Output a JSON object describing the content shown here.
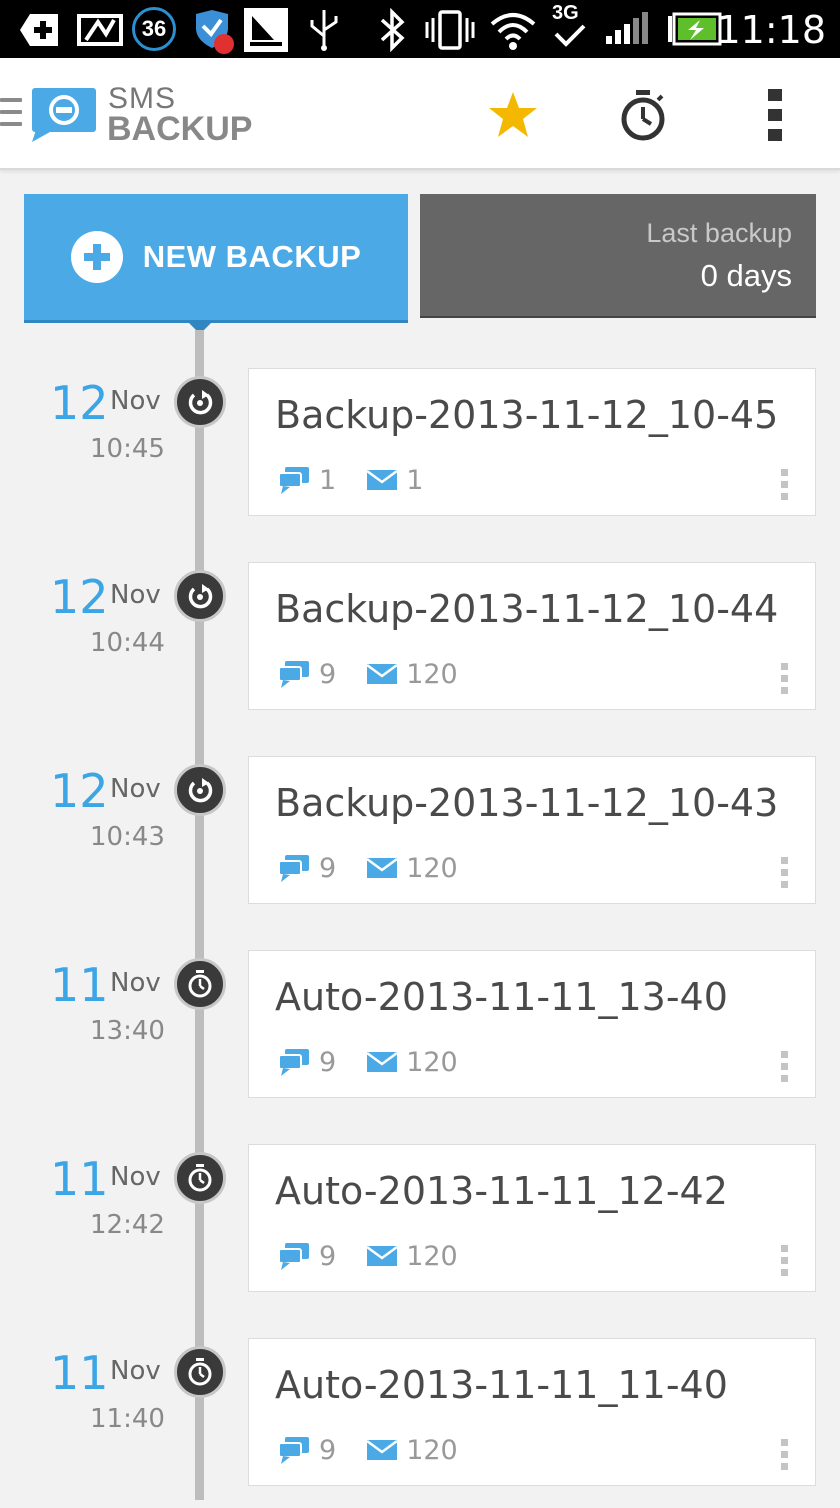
{
  "status_bar": {
    "time": "11:18",
    "notification_badge": "36",
    "network_label": "3G",
    "icons": [
      "add-icon",
      "broken-image-icon",
      "badge-36-icon",
      "shield-ad-icon",
      "sailing-icon",
      "usb-icon",
      "bluetooth-icon",
      "vibrate-icon",
      "wifi-icon",
      "3g-data-icon",
      "signal-icon",
      "battery-charging-icon"
    ]
  },
  "action_bar": {
    "app_name_line1": "SMS",
    "app_name_line2": "BACKUP",
    "actions": [
      "star-icon",
      "timer-icon",
      "overflow-menu-icon"
    ],
    "star_color": "#f5b800"
  },
  "header": {
    "new_backup_label": "NEW BACKUP",
    "last_backup_title": "Last backup",
    "last_backup_value": "0 days",
    "accent_color": "#4baae6"
  },
  "backups": [
    {
      "day": "12",
      "month": "Nov",
      "time": "10:45",
      "name": "Backup-2013-11-12_10-45",
      "type": "manual",
      "conversations": "1",
      "messages": "1"
    },
    {
      "day": "12",
      "month": "Nov",
      "time": "10:44",
      "name": "Backup-2013-11-12_10-44",
      "type": "manual",
      "conversations": "9",
      "messages": "120"
    },
    {
      "day": "12",
      "month": "Nov",
      "time": "10:43",
      "name": "Backup-2013-11-12_10-43",
      "type": "manual",
      "conversations": "9",
      "messages": "120"
    },
    {
      "day": "11",
      "month": "Nov",
      "time": "13:40",
      "name": "Auto-2013-11-11_13-40",
      "type": "auto",
      "conversations": "9",
      "messages": "120"
    },
    {
      "day": "11",
      "month": "Nov",
      "time": "12:42",
      "name": "Auto-2013-11-11_12-42",
      "type": "auto",
      "conversations": "9",
      "messages": "120"
    },
    {
      "day": "11",
      "month": "Nov",
      "time": "11:40",
      "name": "Auto-2013-11-11_11-40",
      "type": "auto",
      "conversations": "9",
      "messages": "120"
    }
  ]
}
